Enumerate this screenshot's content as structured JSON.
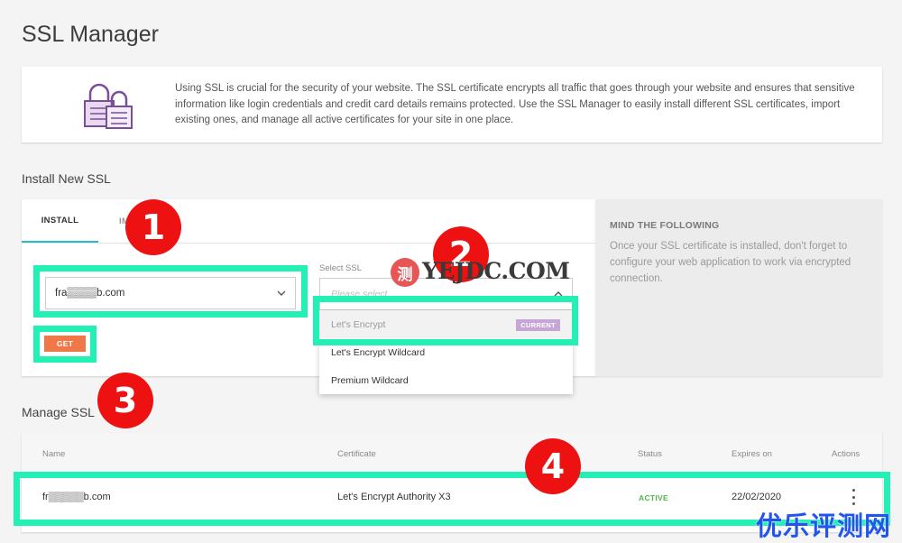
{
  "page": {
    "title": "SSL Manager"
  },
  "intro": {
    "text": "Using SSL is crucial for the security of your website. The SSL certificate encrypts all traffic that goes through your website and ensures that sensitive information like login credentials and credit card details remains protected. Use the SSL Manager to easily install different SSL certificates, import existing ones, and manage all active certificates for your site in one place."
  },
  "install": {
    "section_label": "Install New SSL",
    "tabs": [
      {
        "label": "INSTALL"
      },
      {
        "label": "IM"
      }
    ],
    "domain_select": {
      "value": "fra▒▒▒▒b.com"
    },
    "get_button": "GET",
    "ssl_select": {
      "label": "Select SSL",
      "placeholder": "Please select",
      "options": [
        {
          "label": "Let's Encrypt",
          "badge": "CURRENT"
        },
        {
          "label": "Let's Encrypt Wildcard"
        },
        {
          "label": "Premium Wildcard"
        }
      ]
    }
  },
  "mind": {
    "title": "MIND THE FOLLOWING",
    "text": "Once your SSL certificate is installed, don't forget to configure your web application to work via encrypted connection."
  },
  "manage": {
    "section_label": "Manage SSL",
    "columns": [
      "Name",
      "Certificate",
      "Status",
      "Expires on",
      "Actions"
    ],
    "rows": [
      {
        "name": "fr▒▒▒▒▒b.com",
        "certificate": "Let's Encrypt Authority X3",
        "status": "ACTIVE",
        "expires": "22/02/2020"
      }
    ]
  },
  "annotations": {
    "numbers": [
      "1",
      "2",
      "3",
      "4"
    ],
    "highlight_color": "#22f0b4",
    "circle_color": "#ee1111"
  },
  "watermarks": {
    "center_logo": "测",
    "center_text": "YEJDC.COM",
    "corner_text": "优乐评测网"
  },
  "colors": {
    "accent_tab": "#2fb8c8",
    "get_button": "#f07848",
    "current_badge": "#c6a6d6",
    "active_status": "#4cb84a"
  }
}
